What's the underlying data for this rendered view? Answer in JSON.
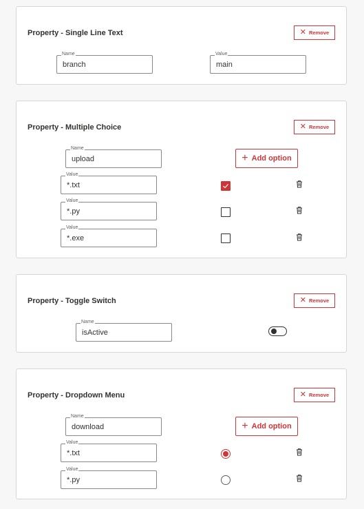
{
  "common": {
    "remove_label": "Remove",
    "add_option_label": "Add option"
  },
  "cards": {
    "single": {
      "title": "Property - Single Line Text",
      "name_label": "Name",
      "name_value": "branch",
      "value_label": "Value",
      "value_value": "main"
    },
    "multi": {
      "title": "Property - Multiple Choice",
      "name_label": "Name",
      "name_value": "upload",
      "options": [
        {
          "label": "Value",
          "value": "*.txt",
          "checked": true
        },
        {
          "label": "Value",
          "value": "*.py",
          "checked": false
        },
        {
          "label": "Value",
          "value": "*.exe",
          "checked": false
        }
      ]
    },
    "toggle": {
      "title": "Property - Toggle Switch",
      "name_label": "Name",
      "name_value": "isActive",
      "state": "off"
    },
    "dropdown": {
      "title": "Property - Dropdown Menu",
      "name_label": "Name",
      "name_value": "download",
      "options": [
        {
          "label": "Value",
          "value": "*.txt",
          "selected": true
        },
        {
          "label": "Value",
          "value": "*.py",
          "selected": false
        }
      ]
    }
  },
  "colors": {
    "accent": "#d13438",
    "border": "#8a8886",
    "card_border": "#d6d6d6"
  }
}
